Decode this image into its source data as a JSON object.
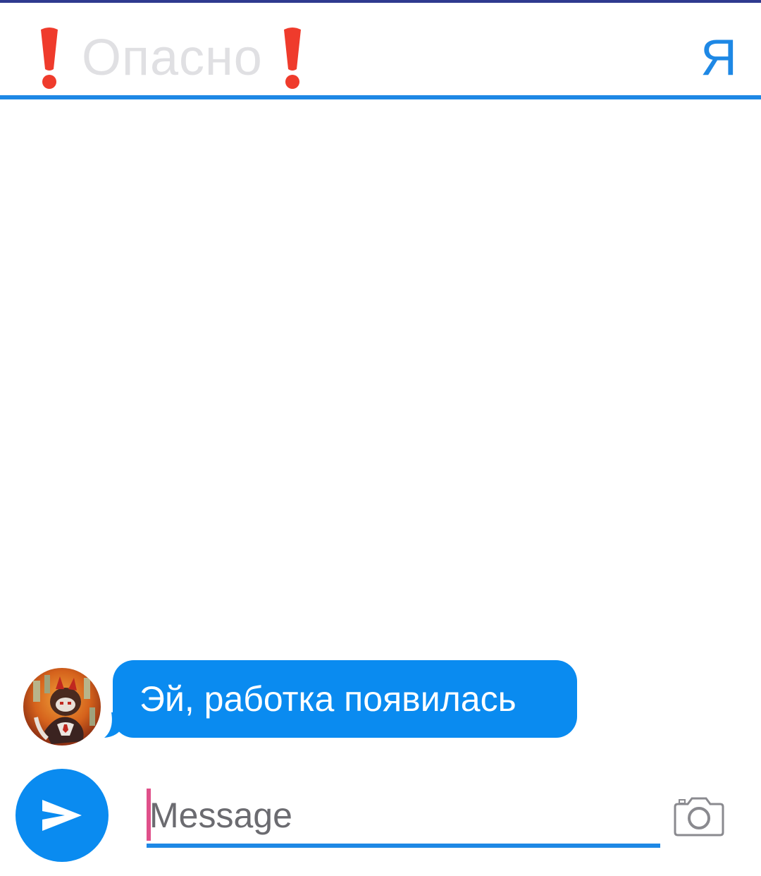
{
  "header": {
    "title": "Опасно",
    "exclamation_icon": "red-exclamation-icon",
    "me_label": "Я"
  },
  "chat": {
    "messages": [
      {
        "text": "Эй, работка появилась",
        "avatar": "cartoon-character-avatar"
      }
    ]
  },
  "composer": {
    "placeholder": "Message",
    "value": "",
    "send_icon": "send-arrow-icon",
    "camera_icon": "camera-icon"
  },
  "colors": {
    "accent": "#1e88e5",
    "bubble": "#0a8bf0",
    "title_text": "#e0e0e3",
    "exclamation": "#ef3b2c",
    "caret": "#e0508a"
  }
}
